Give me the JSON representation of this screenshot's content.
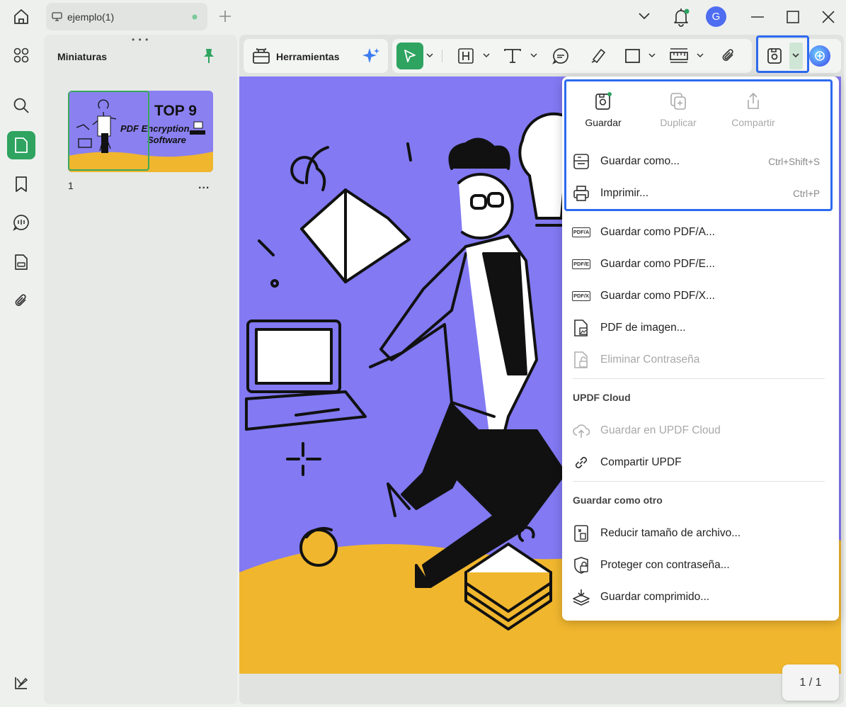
{
  "titlebar": {
    "tab_title": "ejemplo(1)",
    "avatar_letter": "G"
  },
  "thumbnails_panel": {
    "title": "Miniaturas",
    "thumbnail": {
      "page_number": "1",
      "more": "...",
      "text_line1": "TOP 9",
      "text_line2": "PDF Encryption",
      "text_line3": "Software"
    }
  },
  "toolbar": {
    "tools_label": "Herramientas"
  },
  "save_menu": {
    "quick_actions": [
      {
        "label": "Guardar",
        "icon": "save-icon"
      },
      {
        "label": "Duplicar",
        "icon": "duplicate-icon"
      },
      {
        "label": "Compartir",
        "icon": "share-icon"
      }
    ],
    "items_top": [
      {
        "label": "Guardar como...",
        "shortcut": "Ctrl+Shift+S",
        "icon": "save-as-icon"
      },
      {
        "label": "Imprimir...",
        "shortcut": "Ctrl+P",
        "icon": "printer-icon"
      }
    ],
    "badges": {
      "pdfa": "PDF/A",
      "pdfe": "PDF/E",
      "pdfx": "PDF/X"
    },
    "items_formats": [
      {
        "label": "Guardar como PDF/A..."
      },
      {
        "label": "Guardar como PDF/E..."
      },
      {
        "label": "Guardar como PDF/X..."
      },
      {
        "label": "PDF de imagen..."
      },
      {
        "label": "Eliminar Contraseña",
        "disabled": true
      }
    ],
    "cloud_section": {
      "title": "UPDF Cloud",
      "items": [
        {
          "label": "Guardar en UPDF Cloud",
          "disabled": true
        },
        {
          "label": "Compartir UPDF"
        }
      ]
    },
    "other_section": {
      "title": "Guardar como otro",
      "items": [
        {
          "label": "Reducir tamaño de archivo..."
        },
        {
          "label": "Proteger con contraseña..."
        },
        {
          "label": "Guardar comprimido..."
        }
      ]
    }
  },
  "page_indicator": "1 / 1",
  "colors": {
    "accent_green": "#2ea460",
    "highlight_blue": "#2d6af0",
    "page_purple": "#8279f3",
    "page_yellow": "#f0b62e"
  }
}
